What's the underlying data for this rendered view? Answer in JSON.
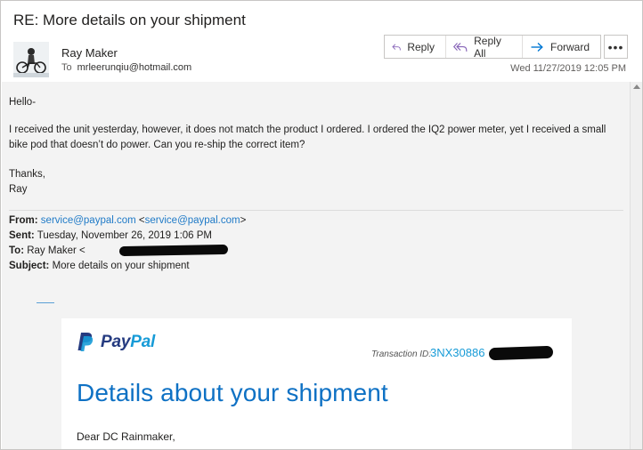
{
  "email": {
    "subject": "RE: More details on your shipment",
    "sender_name": "Ray Maker",
    "to_label": "To",
    "to_address": "mrleerunqiu@hotmail.com",
    "date": "Wed 11/27/2019 12:05 PM"
  },
  "actions": {
    "reply": "Reply",
    "reply_all": "Reply All",
    "forward": "Forward",
    "more": "•••"
  },
  "body": {
    "greeting": "Hello-",
    "paragraph": "I received the unit yesterday, however, it does not match the product I ordered. I ordered the IQ2 power meter, yet I received a small bike pod that doesn’t do power. Can you re-ship the correct item?",
    "signoff": "Thanks,",
    "signature": "Ray"
  },
  "quoted": {
    "from_label": "From:",
    "from_email": "service@paypal.com",
    "from_email_bracket": "<service@paypal.com>",
    "sent_label": "Sent:",
    "sent_value": "Tuesday, November 26, 2019 1:06 PM",
    "to_label": "To:",
    "to_value": "Ray Maker <",
    "subject_label": "Subject:",
    "subject_value": "More details on your shipment"
  },
  "paypal": {
    "logo_pay": "Pay",
    "logo_pal": "Pal",
    "transaction_label": "Transaction ID:",
    "transaction_id": "3NX30886",
    "title": "Details about your shipment",
    "salutation": "Dear DC Rainmaker,"
  },
  "colors": {
    "paypal_dark_blue": "#253b80",
    "paypal_light_blue": "#179bd7",
    "title_blue": "#0e71c4",
    "link_blue": "#1f7ac7",
    "action_icon_purple": "#8764b8",
    "forward_icon_blue": "#0078d4"
  }
}
